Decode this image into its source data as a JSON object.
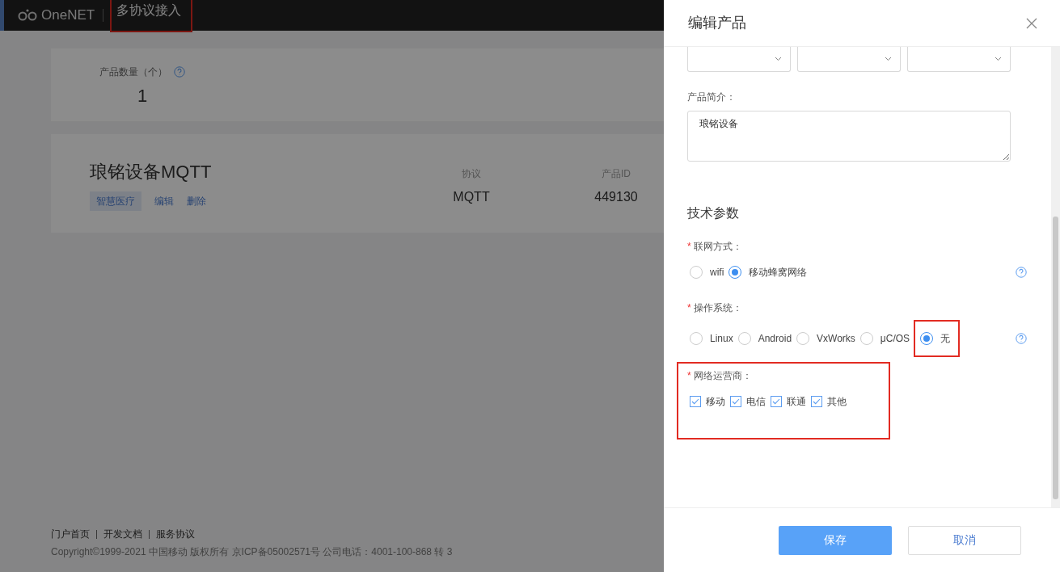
{
  "header": {
    "logo": "OneNET",
    "title": "多协议接入",
    "highlighted": true
  },
  "stats": [
    {
      "label": "产品数量（个）",
      "value": "1"
    }
  ],
  "products": [
    {
      "name": "琅铭设备MQTT",
      "tag": "智慧医疗",
      "actions": [
        "编辑",
        "删除"
      ],
      "fields": [
        {
          "label": "协议",
          "value": "MQTT"
        },
        {
          "label": "产品ID",
          "value": "449130"
        }
      ]
    }
  ],
  "footer": {
    "links": [
      "门户首页",
      "开发文档",
      "服务协议"
    ],
    "copyright": "Copyright©1999-2021 中国移动 版权所有 京ICP备05002571号 公司电话：4001-100-868 转 3"
  },
  "drawer": {
    "title": "编辑产品",
    "description": {
      "label": "产品简介：",
      "value": "琅铭设备"
    },
    "section": "技术参数",
    "groups": [
      {
        "kind": "radio",
        "required_mark": "*",
        "label": "联网方式：",
        "help": true,
        "highlighted": false,
        "options": [
          {
            "label": "wifi",
            "selected": false,
            "highlighted": false
          },
          {
            "label": "移动蜂窝网络",
            "selected": true,
            "highlighted": false
          }
        ]
      },
      {
        "kind": "radio",
        "required_mark": "*",
        "label": "操作系统：",
        "help": true,
        "highlighted": false,
        "options": [
          {
            "label": "Linux",
            "selected": false,
            "highlighted": false
          },
          {
            "label": "Android",
            "selected": false,
            "highlighted": false
          },
          {
            "label": "VxWorks",
            "selected": false,
            "highlighted": false
          },
          {
            "label": "μC/OS",
            "selected": false,
            "highlighted": false
          },
          {
            "label": "无",
            "selected": true,
            "highlighted": true
          }
        ]
      },
      {
        "kind": "checkbox",
        "required_mark": "*",
        "label": "网络运营商：",
        "help": false,
        "highlighted": true,
        "options": [
          {
            "label": "移动",
            "checked": true
          },
          {
            "label": "电信",
            "checked": true
          },
          {
            "label": "联通",
            "checked": true
          },
          {
            "label": "其他",
            "checked": true
          }
        ]
      }
    ],
    "buttons": [
      {
        "label": "保存",
        "kind": "primary"
      },
      {
        "label": "取消",
        "kind": "secondary"
      }
    ]
  }
}
